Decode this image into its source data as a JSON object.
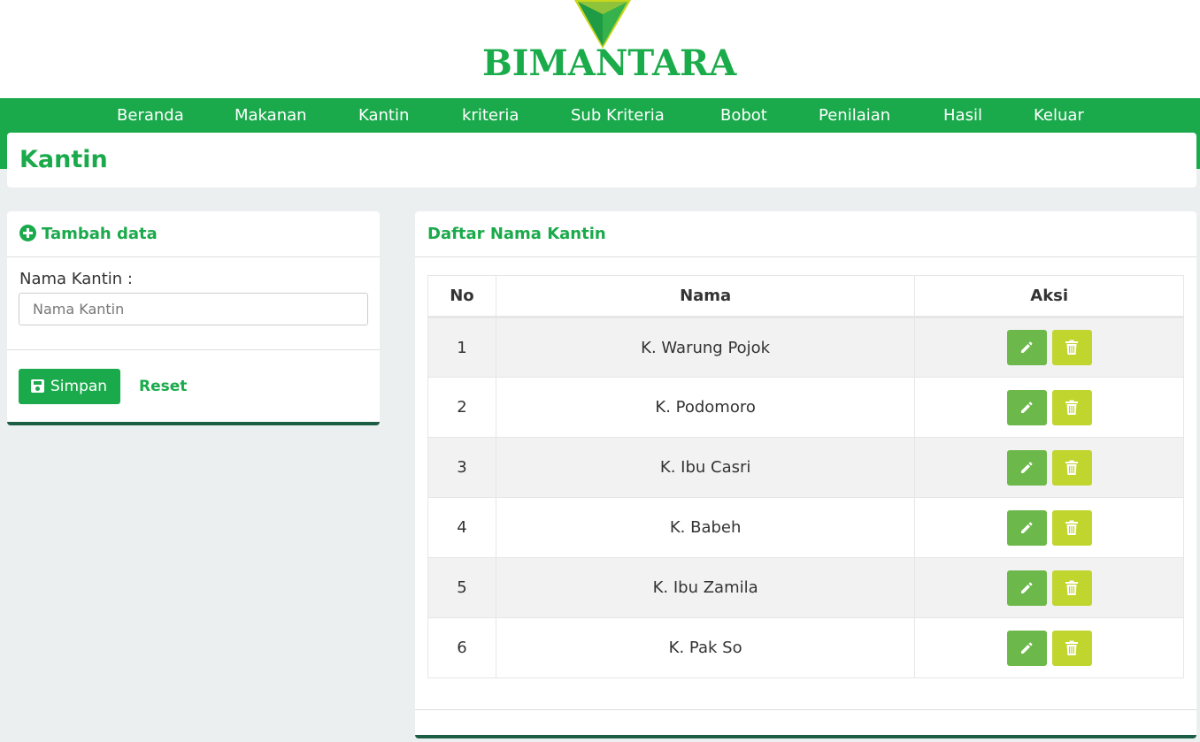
{
  "brand": {
    "name": "BIMANTARA",
    "color": "#1aab4a"
  },
  "nav": {
    "items": [
      {
        "label": "Beranda"
      },
      {
        "label": "Makanan"
      },
      {
        "label": "Kantin"
      },
      {
        "label": "kriteria"
      },
      {
        "label": "Sub Kriteria"
      },
      {
        "label": "Bobot"
      },
      {
        "label": "Penilaian"
      },
      {
        "label": "Hasil"
      },
      {
        "label": "Keluar"
      }
    ]
  },
  "page": {
    "title": "Kantin"
  },
  "form": {
    "heading": "Tambah data",
    "field_label": "Nama Kantin :",
    "field_value": "",
    "field_placeholder": "Nama Kantin",
    "save_label": "Simpan",
    "reset_label": "Reset"
  },
  "list": {
    "heading": "Daftar Nama Kantin",
    "columns": {
      "no": "No",
      "nama": "Nama",
      "aksi": "Aksi"
    },
    "rows": [
      {
        "no": "1",
        "nama": "K. Warung Pojok"
      },
      {
        "no": "2",
        "nama": "K. Podomoro"
      },
      {
        "no": "3",
        "nama": "K. Ibu Casri"
      },
      {
        "no": "4",
        "nama": "K. Babeh"
      },
      {
        "no": "5",
        "nama": "K. Ibu Zamila"
      },
      {
        "no": "6",
        "nama": "K. Pak So"
      }
    ],
    "row_actions": {
      "edit_icon": "pencil-icon",
      "delete_icon": "trash-icon"
    }
  },
  "colors": {
    "primary": "#1aaa4b",
    "edit": "#6db84a",
    "delete": "#c0d52e",
    "accent_border": "#1b5e44"
  }
}
